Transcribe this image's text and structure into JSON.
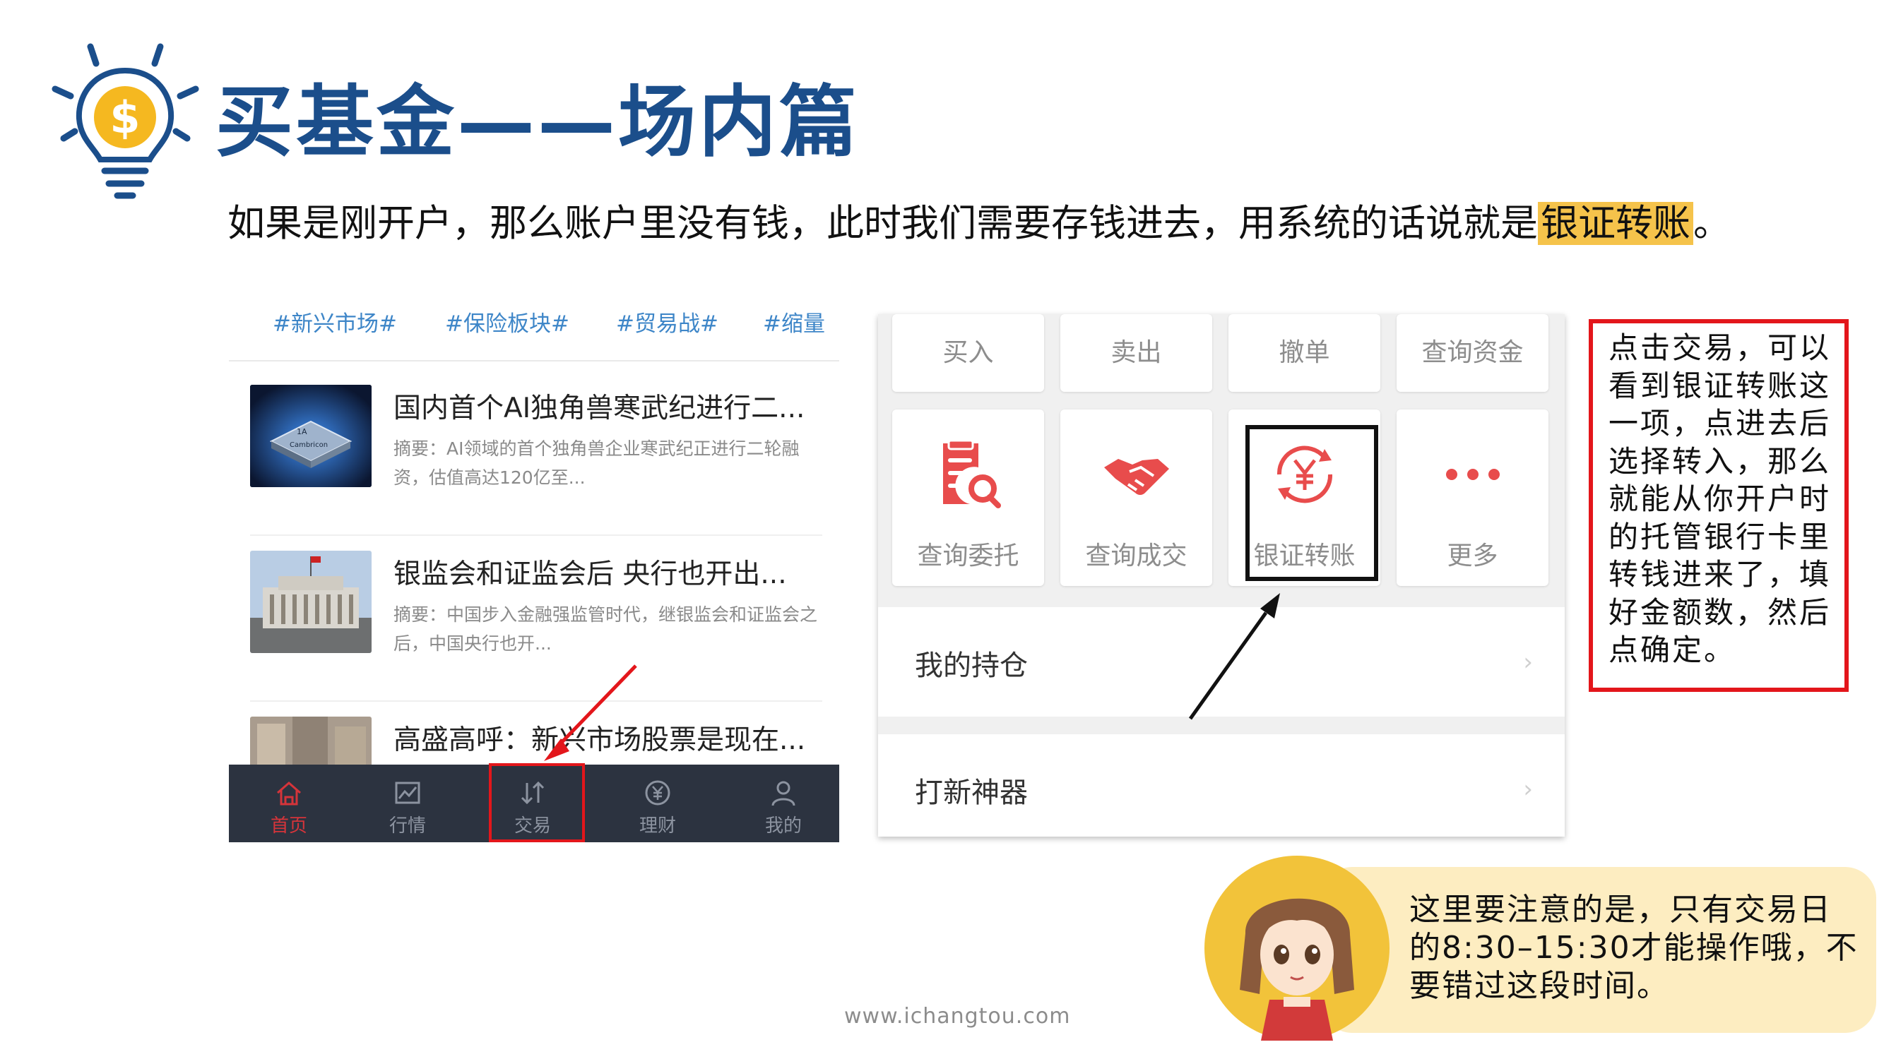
{
  "title": "买基金——场内篇",
  "subtitle": {
    "text": "如果是刚开户，那么账户里没有钱，此时我们需要存钱进去，用系统的话说就是",
    "highlight": "银证转账",
    "end": "。"
  },
  "phone": {
    "tags": [
      "#新兴市场#",
      "#保险板块#",
      "#贸易战#",
      "#缩量"
    ],
    "news": [
      {
        "title": "国内首个AI独角兽寒武纪进行二...",
        "abstract": "摘要：AI领域的首个独角兽企业寒武纪正进行二轮融资，估值高达120亿至...",
        "thumb_text_1": "1A",
        "thumb_text_2": "Cambricon"
      },
      {
        "title": "银监会和证监会后 央行也开出...",
        "abstract": "摘要：中国步入金融强监管时代，继银监会和证监会之后，中国央行也开..."
      },
      {
        "title": "高盛高呼：新兴市场股票是现在..."
      }
    ],
    "tabs": [
      {
        "label": "首页",
        "icon": "home-icon"
      },
      {
        "label": "行情",
        "icon": "chart-icon"
      },
      {
        "label": "交易",
        "icon": "transfer-arrows-icon"
      },
      {
        "label": "理财",
        "icon": "yen-circle-icon"
      },
      {
        "label": "我的",
        "icon": "user-icon"
      }
    ]
  },
  "trade": {
    "top_buttons": [
      "买入",
      "卖出",
      "撤单",
      "查询资金"
    ],
    "big_buttons": [
      {
        "label": "查询委托",
        "icon": "query-order-icon"
      },
      {
        "label": "查询成交",
        "icon": "handshake-icon"
      },
      {
        "label": "银证转账",
        "icon": "yen-transfer-icon"
      },
      {
        "label": "更多",
        "icon": "more-dots-icon"
      }
    ],
    "rows": [
      {
        "label": "我的持仓",
        "chevron": "›"
      },
      {
        "label": "打新神器",
        "chevron": "›"
      }
    ]
  },
  "note": "点击交易，可以看到银证转账这一项，点进去后选择转入，那么就能从你开户时的托管银行卡里转钱进来了，填好金额数，然后点确定。",
  "tip": "这里要注意的是，只有交易日的8:30–15:30才能操作哦，不要错过这段时间。",
  "footer": "www.ichangtou.com",
  "colors": {
    "title": "#1b4e8b",
    "highlight": "#f5c34b",
    "red": "#e3161b",
    "tabbar": "#2c3340",
    "tag": "#3e86c8",
    "tip_bg": "#fdedc1",
    "avatar_bg": "#f2c33a"
  }
}
